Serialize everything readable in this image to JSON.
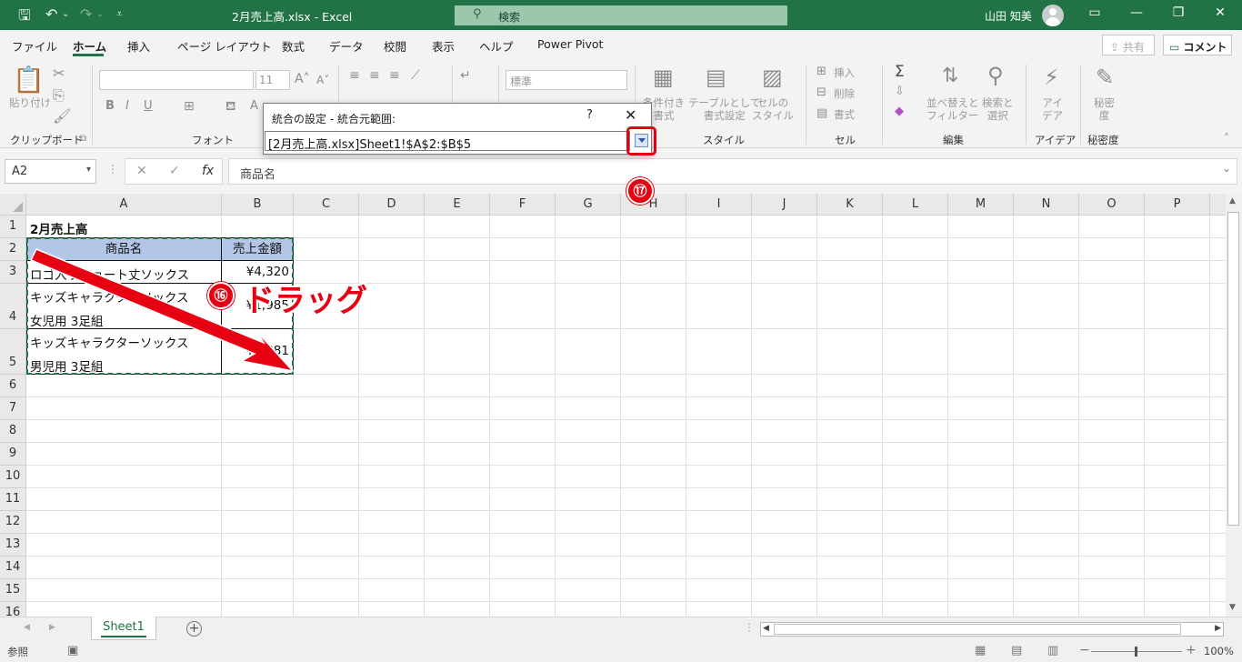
{
  "titlebar": {
    "document_title": "2月売上高.xlsx  -  Excel",
    "search_placeholder": "検索",
    "user_name": "山田 知美",
    "accent_color": "#217346"
  },
  "menu": {
    "tabs": [
      "ファイル",
      "ホーム",
      "挿入",
      "ページ レイアウト",
      "数式",
      "データ",
      "校閲",
      "表示",
      "ヘルプ",
      "Power Pivot"
    ],
    "active_tab": "ホーム",
    "share_label": "共有",
    "comment_label": "コメント"
  },
  "ribbon": {
    "groups": {
      "clipboard": "クリップボード",
      "font": "フォント",
      "style": "スタイル",
      "cells": "セル",
      "editing": "編集",
      "ideas": "アイデア",
      "sensitivity": "秘密度"
    },
    "paste_label": "貼り付け",
    "font_size": "11",
    "number_format": "標準",
    "conditional_format": "条件付き\n書式",
    "format_as_table": "テーブルとして\n書式設定",
    "cell_styles": "セルの\nスタイル",
    "insert": "挿入",
    "delete": "削除",
    "format": "書式",
    "sort_filter": "並べ替えと\nフィルター",
    "find_select": "検索と\n選択",
    "ideas_btn": "アイ\nデア",
    "sensitivity_btn": "秘密\n度"
  },
  "formula_bar": {
    "name_box": "A2",
    "formula": "商品名"
  },
  "sheet": {
    "columns": [
      "A",
      "B",
      "C",
      "D",
      "E",
      "F",
      "G",
      "H",
      "I",
      "J",
      "K",
      "L",
      "M",
      "N",
      "O",
      "P"
    ],
    "rows": [
      "1",
      "2",
      "3",
      "4",
      "5",
      "6",
      "7",
      "8",
      "9",
      "10",
      "11",
      "12",
      "13",
      "14",
      "15",
      "16"
    ],
    "cells": {
      "A1": "2月売上高",
      "A2": "商品名",
      "B2": "売上金額",
      "A3": "ロゴ入りショート丈ソックス",
      "B3": "¥4,320",
      "A4_line1": "キッズキャラクターソックス",
      "A4_line2": "女児用 3足組",
      "B4": "¥1,985",
      "A5_line1": "キッズキャラクターソックス",
      "A5_line2": "男児用 3足組",
      "B5": "¥1,881"
    },
    "header_fill": "#b4c6e7"
  },
  "dialog": {
    "title": "統合の設定 - 統合元範囲:",
    "help": "?",
    "close": "✕",
    "range_value": "[2月売上高.xlsx]Sheet1!$A$2:$B$5"
  },
  "annotations": {
    "step16": "⑯",
    "drag_text": "ドラッグ",
    "step17": "⑰",
    "highlight_color": "#e60012"
  },
  "sheet_tabs": {
    "active": "Sheet1",
    "add": "+"
  },
  "statusbar": {
    "mode": "参照",
    "zoom": "100%"
  }
}
